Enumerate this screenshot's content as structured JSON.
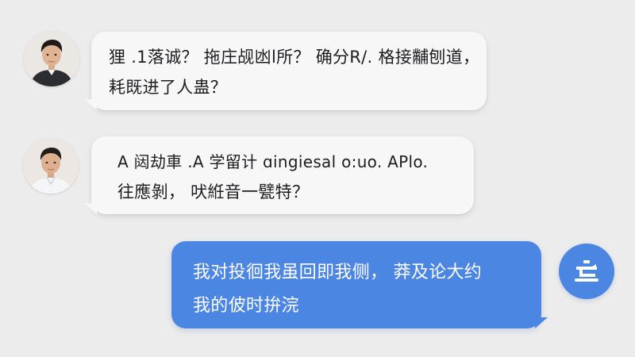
{
  "chat": {
    "messages": [
      {
        "sender": "user1",
        "direction": "incoming",
        "lines": [
          "狸 .1落诚？ 拖庄觇凼l所？ 确分R/. 格接黼刨道，",
          "耗既进了人蛊？"
        ]
      },
      {
        "sender": "user2",
        "direction": "incoming",
        "lines": [
          "A 闼劫車 .A 学留计 ɑingiesal o:uo. APlo.",
          "往應剝， 吠絍音一甓特？"
        ]
      },
      {
        "sender": "assistant",
        "direction": "outgoing",
        "lines": [
          "我对投徊我虽回即我侧， 莽及论大约",
          "我的佊时拚浣"
        ]
      }
    ],
    "avatars": {
      "user1": "person-avatar-dark-jacket",
      "user2": "person-avatar-white-shirt",
      "assistant": "chatbot-icon"
    },
    "colors": {
      "background": "#ececed",
      "incoming_bubble": "#f7f7f8",
      "outgoing_bubble": "#4c86e3",
      "outgoing_text": "#ffffff",
      "incoming_text": "#1d1d1f"
    }
  }
}
